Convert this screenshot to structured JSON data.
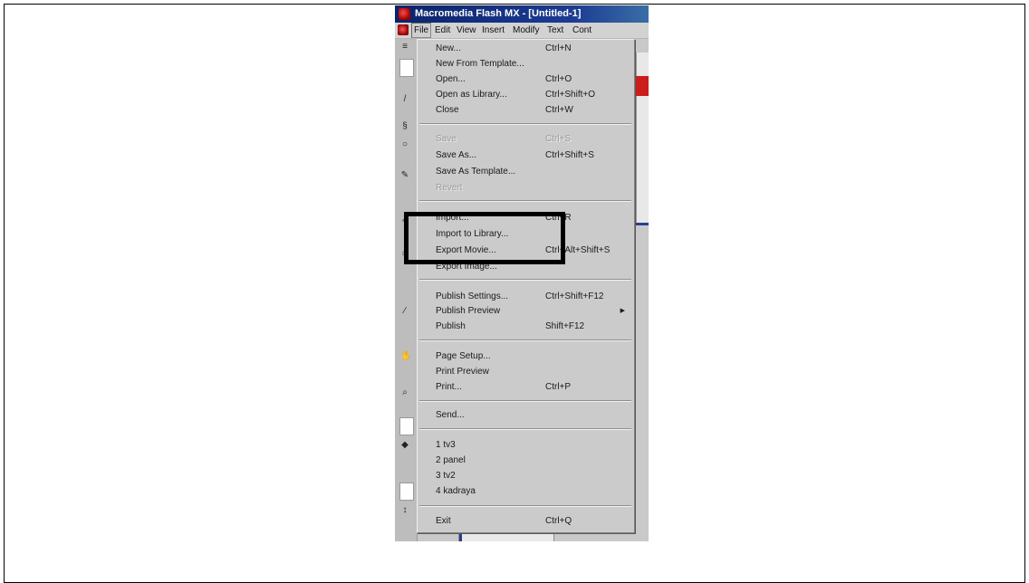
{
  "window": {
    "title": "Macromedia Flash MX - [Untitled-1]"
  },
  "menubar": {
    "items": [
      "File",
      "Edit",
      "View",
      "Insert",
      "Modify",
      "Text",
      "Cont"
    ]
  },
  "file_menu": {
    "groups": [
      [
        {
          "label": "New...",
          "shortcut": "Ctrl+N",
          "enabled": true
        },
        {
          "label": "New From Template...",
          "shortcut": "",
          "enabled": true
        },
        {
          "label": "Open...",
          "shortcut": "Ctrl+O",
          "enabled": true
        },
        {
          "label": "Open as Library...",
          "shortcut": "Ctrl+Shift+O",
          "enabled": true
        },
        {
          "label": "Close",
          "shortcut": "Ctrl+W",
          "enabled": true
        }
      ],
      [
        {
          "label": "Save",
          "shortcut": "Ctrl+S",
          "enabled": false
        },
        {
          "label": "Save As...",
          "shortcut": "Ctrl+Shift+S",
          "enabled": true
        },
        {
          "label": "Save As Template...",
          "shortcut": "",
          "enabled": true
        },
        {
          "label": "Revert",
          "shortcut": "",
          "enabled": false
        }
      ],
      [
        {
          "label": "Import...",
          "shortcut": "Ctrl+R",
          "enabled": true
        },
        {
          "label": "Import to Library...",
          "shortcut": "",
          "enabled": true
        },
        {
          "label": "Export Movie...",
          "shortcut": "Ctrl+Alt+Shift+S",
          "enabled": true
        },
        {
          "label": "Export Image...",
          "shortcut": "",
          "enabled": true
        }
      ],
      [
        {
          "label": "Publish Settings...",
          "shortcut": "Ctrl+Shift+F12",
          "enabled": true
        },
        {
          "label": "Publish Preview",
          "shortcut": "",
          "enabled": true,
          "submenu": true
        },
        {
          "label": "Publish",
          "shortcut": "Shift+F12",
          "enabled": true
        }
      ],
      [
        {
          "label": "Page Setup...",
          "shortcut": "",
          "enabled": true
        },
        {
          "label": "Print Preview",
          "shortcut": "",
          "enabled": true
        },
        {
          "label": "Print...",
          "shortcut": "Ctrl+P",
          "enabled": true
        }
      ],
      [
        {
          "label": "Send...",
          "shortcut": "",
          "enabled": true
        }
      ],
      [
        {
          "label": "1 tv3",
          "shortcut": "",
          "enabled": true
        },
        {
          "label": "2 panel",
          "shortcut": "",
          "enabled": true
        },
        {
          "label": "3 tv2",
          "shortcut": "",
          "enabled": true
        },
        {
          "label": "4 kadraya",
          "shortcut": "",
          "enabled": true
        }
      ],
      [
        {
          "label": "Exit",
          "shortcut": "Ctrl+Q",
          "enabled": true
        }
      ]
    ]
  },
  "colors": {
    "titlebar": "#0a246a",
    "menu_bg": "#cbcbcb",
    "highlight_box": "#000000"
  },
  "icons": {
    "app_icon": "flash-logo-icon",
    "submenu_arrow": "submenu-arrow-icon"
  }
}
